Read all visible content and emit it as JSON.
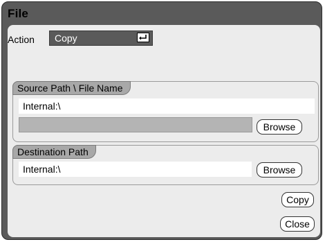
{
  "dialog": {
    "title": "File"
  },
  "action": {
    "label": "Action",
    "value": "Copy"
  },
  "source": {
    "heading": "Source Path \\ File Name",
    "path_value": "Internal:\\",
    "file_value": "",
    "browse_label": "Browse"
  },
  "destination": {
    "heading": "Destination Path",
    "path_value": "Internal:\\",
    "browse_label": "Browse"
  },
  "buttons": {
    "copy_label": "Copy",
    "close_label": "Close"
  }
}
